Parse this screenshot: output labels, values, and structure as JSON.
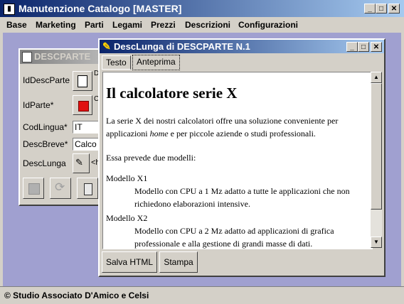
{
  "app": {
    "title": "Manutenzione Catalogo [MASTER]",
    "icon": "book-icon",
    "window_buttons": [
      "minimize-icon",
      "maximize-icon",
      "close-icon"
    ]
  },
  "menu": {
    "items": [
      "Base",
      "Marketing",
      "Parti",
      "Legami",
      "Prezzi",
      "Descrizioni",
      "Configurazioni"
    ]
  },
  "back_window": {
    "title": "DESCPARTE",
    "fields": [
      {
        "label": "IdDescParte",
        "value": "D"
      },
      {
        "label": "IdParte*",
        "value": "C"
      },
      {
        "label": "CodLingua*",
        "value": "IT"
      },
      {
        "label": "DescBreve*",
        "value": "Calco"
      },
      {
        "label": "DescLunga",
        "value": "<h"
      }
    ],
    "toolbar": [
      "save-icon",
      "refresh-icon",
      "delete-icon"
    ]
  },
  "front_window": {
    "title": "DescLunga di DESCPARTE N.1",
    "tabs": {
      "testo": "Testo",
      "anteprima": "Anteprima",
      "active": "Anteprima"
    },
    "preview": {
      "heading": "Il calcolatore serie X",
      "intro_before": "La serie X dei nostri calcolatori offre una soluzione conveniente per applicazioni ",
      "intro_em": "home",
      "intro_after": " e per piccole aziende o studi professionali.",
      "para2": "Essa prevede due modelli:",
      "model1_title": "Modello X1",
      "model1_desc": "Modello con CPU a 1 Mz adatto a tutte le applicazioni che non richiedono elaborazioni intensive.",
      "model2_title": "Modello X2",
      "model2_desc": "Modello con CPU a 2 Mz adatto ad applicazioni di grafica professionale e alla gestione di grandi masse di dati."
    },
    "buttons": {
      "save_html": "Salva HTML",
      "print": "Stampa"
    }
  },
  "status": {
    "text": "© Studio Associato D'Amico e Celsi"
  }
}
